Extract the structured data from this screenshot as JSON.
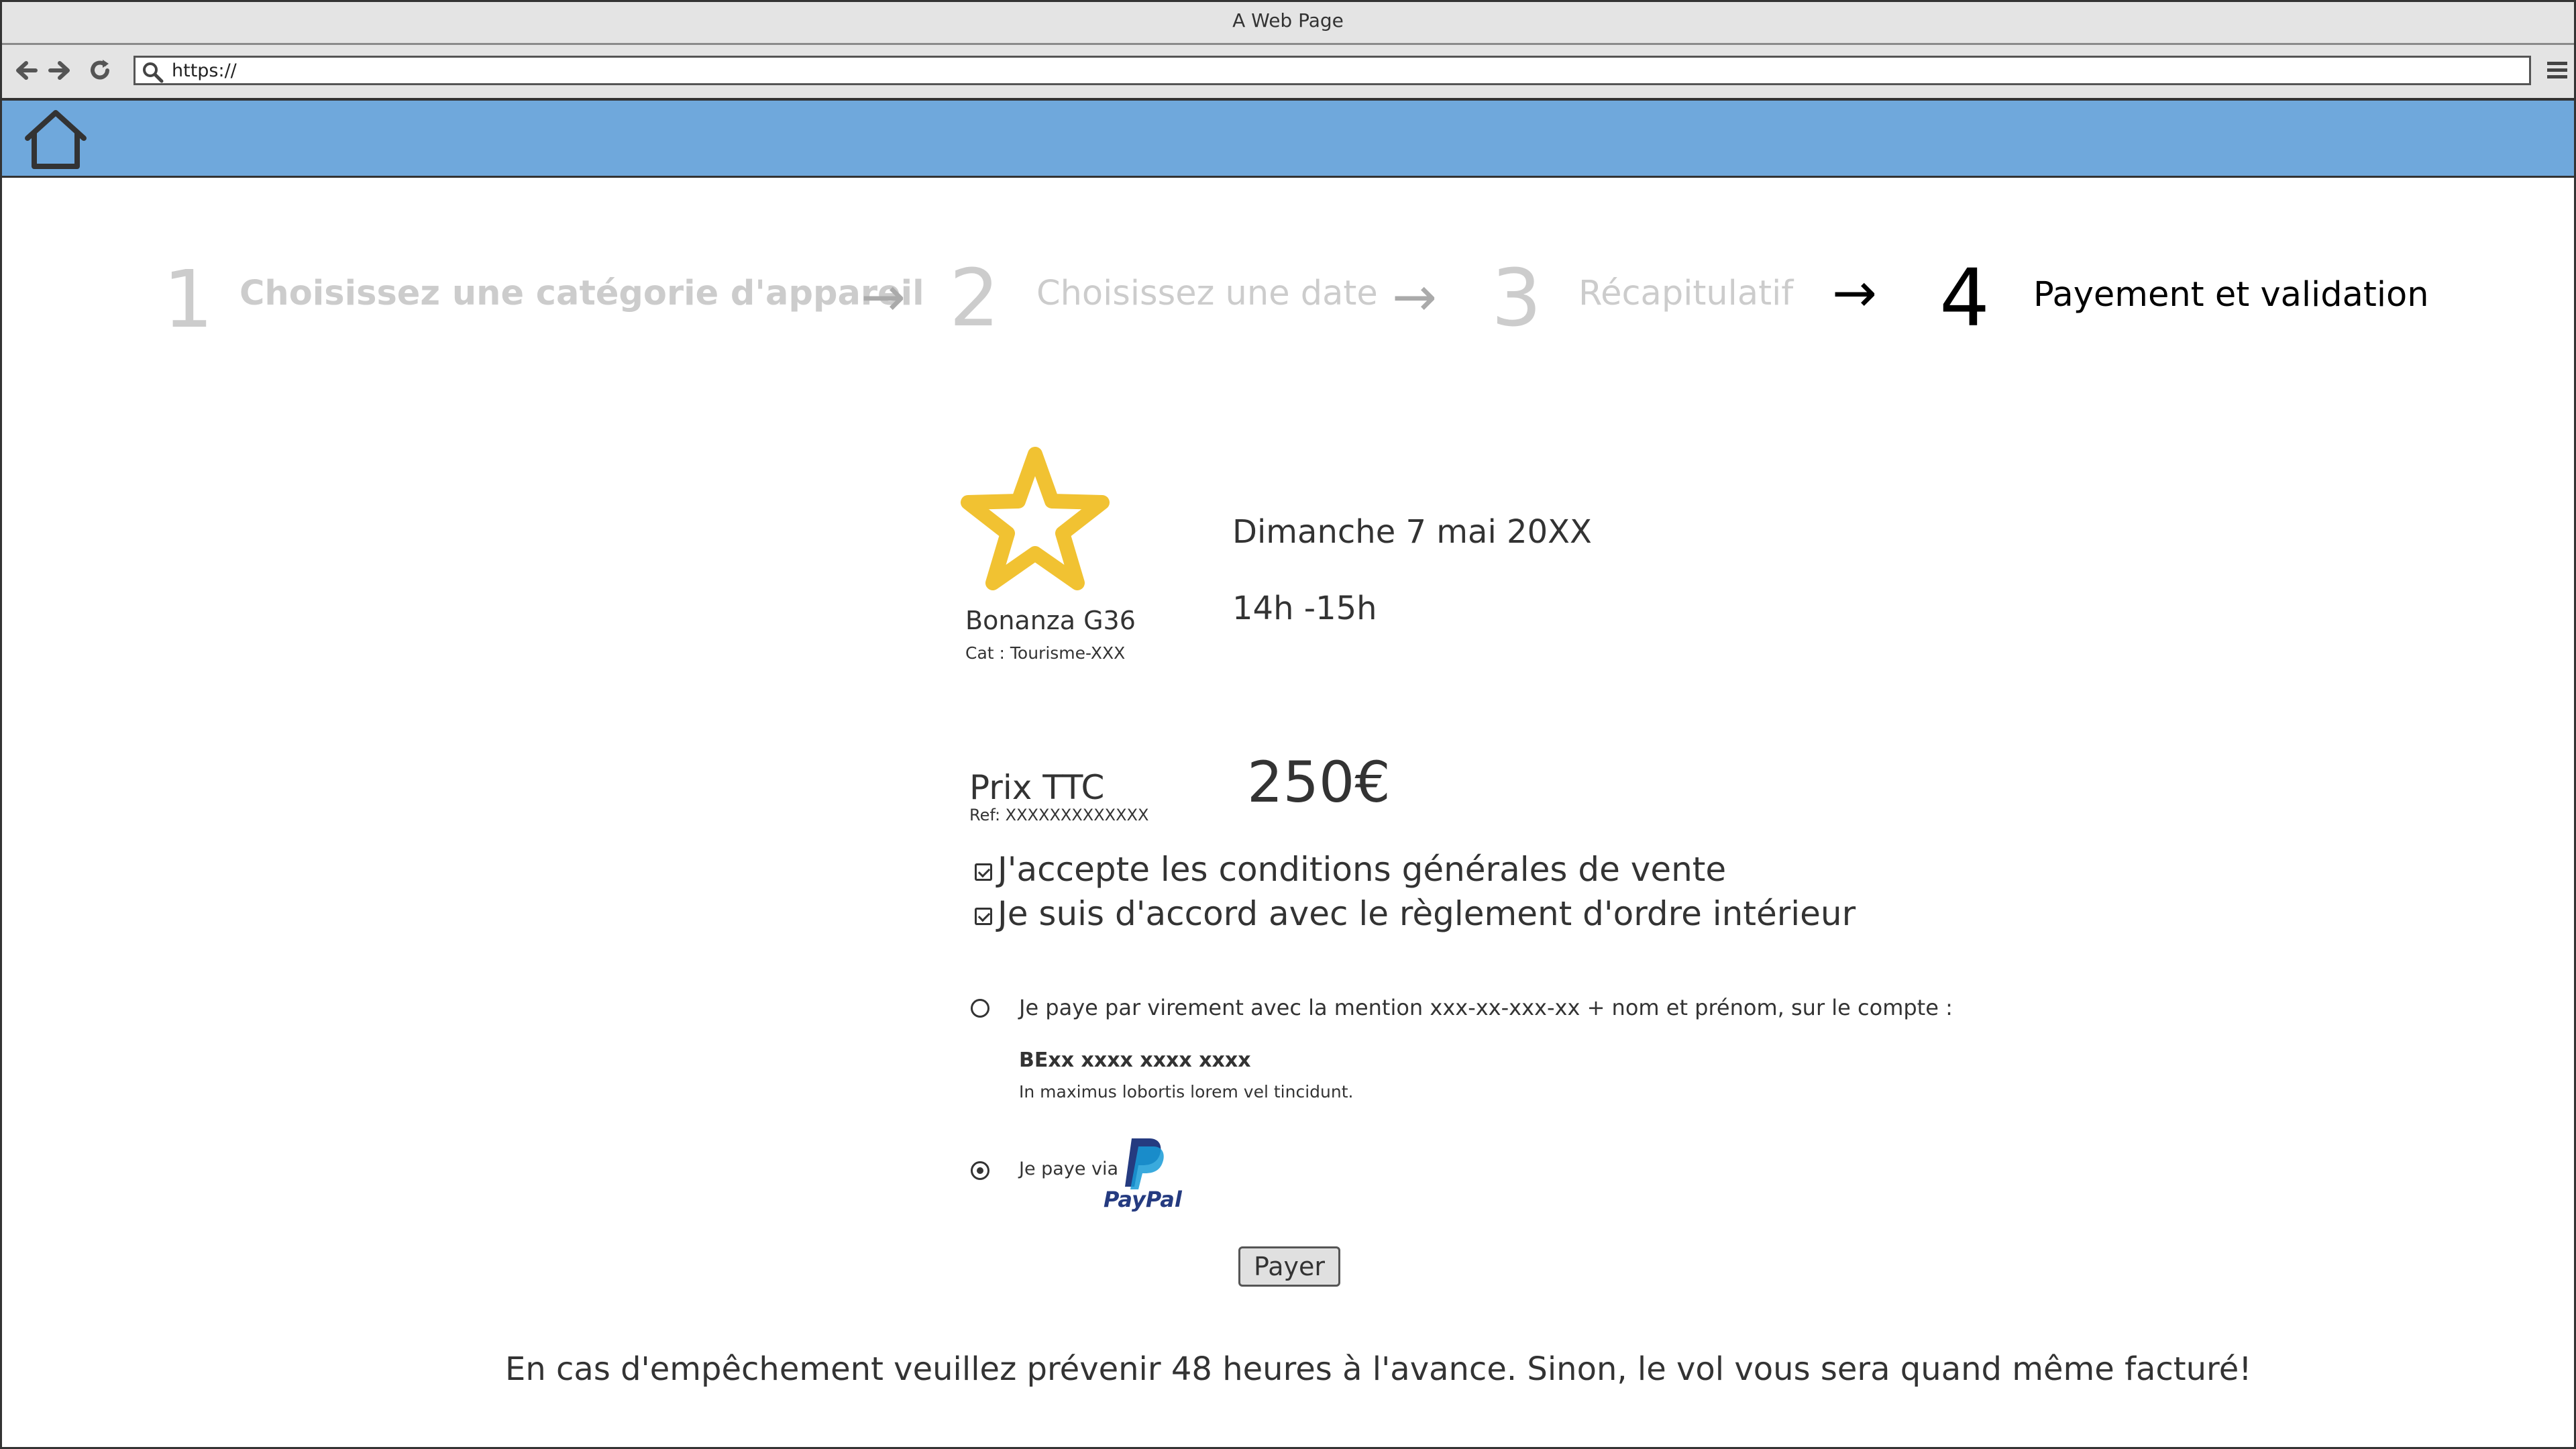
{
  "window": {
    "title": "A Web Page"
  },
  "browser": {
    "url": "https://"
  },
  "steps": [
    {
      "number": "1",
      "label": "Choisissez une catégorie d'appareil",
      "active": false
    },
    {
      "number": "2",
      "label": "Choisissez une date",
      "active": false
    },
    {
      "number": "3",
      "label": "Récapitulatif",
      "active": false
    },
    {
      "number": "4",
      "label": "Payement et validation",
      "active": true
    }
  ],
  "arrow": "→",
  "aircraft": {
    "name": "Bonanza G36",
    "category": "Cat : Tourisme-XXX",
    "icon": "star-icon",
    "icon_color": "#f1c232"
  },
  "booking": {
    "date": "Dimanche 7 mai 20XX",
    "time": "14h -15h"
  },
  "price": {
    "label": "Prix TTC",
    "ref": "Ref: XXXXXXXXXXXXX",
    "amount": "250€"
  },
  "agreements": [
    {
      "label": "J'accepte les conditions générales de vente",
      "checked": true
    },
    {
      "label": "Je suis d'accord avec le règlement d'ordre intérieur",
      "checked": true
    }
  ],
  "payment": {
    "transfer": {
      "label": "Je paye par virement avec la mention xxx-xx-xxx-xx + nom et prénom, sur le compte :",
      "account": "BExx xxxx xxxx xxxx",
      "note": "In maximus lobortis lorem vel tincidunt.",
      "selected": false
    },
    "paypal": {
      "label": "Je paye via",
      "brand": "PayPal",
      "selected": true
    },
    "submit_label": "Payer"
  },
  "footer_notice": "En cas d'empêchement veuillez prévenir 48 heures à l'avance. Sinon, le vol vous sera quand même facturé!"
}
